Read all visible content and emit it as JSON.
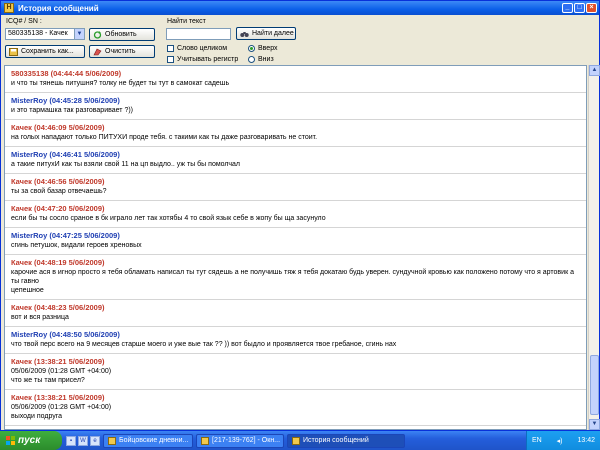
{
  "window": {
    "title": "История сообщений",
    "icon_text": "H"
  },
  "toolbar": {
    "icq_label": "ICQ# / SN :",
    "contact_value": "580335138 - Качек",
    "refresh_label": "Обновить",
    "save_label": "Сохранить как...",
    "clear_label": "Очистить",
    "find_label": "Найти текст",
    "find_value": "",
    "find_next_label": "Найти далее",
    "whole_word_label": "Слово целиком",
    "case_label": "Учитывать регистр",
    "up_label": "Вверх",
    "down_label": "Вниз"
  },
  "messages": [
    {
      "sender": "580335138",
      "time": "(04:44:44 5/06/2009)",
      "who": "them",
      "lines": [
        "и что ты тянешь питушня? толку не будет ты тут в самокат садешь"
      ]
    },
    {
      "sender": "MisterRoy",
      "time": "(04:45:28 5/06/2009)",
      "who": "me",
      "lines": [
        "и это тармашка так разговаривает ?))"
      ]
    },
    {
      "sender": "Качек",
      "time": "(04:46:09 5/06/2009)",
      "who": "them",
      "lines": [
        "на голых нападают только ПИТУХИ проде тебя. с такими как ты даже разговаривать не стоит."
      ]
    },
    {
      "sender": "MisterRoy",
      "time": "(04:46:41 5/06/2009)",
      "who": "me",
      "lines": [
        "а такие питухИ как ты взяли свой 11 на цп выдло.. уж ты бы помолчал"
      ]
    },
    {
      "sender": "Качек",
      "time": "(04:46:56 5/06/2009)",
      "who": "them",
      "lines": [
        "ты за свой базар отвечаешь?"
      ]
    },
    {
      "sender": "Качек",
      "time": "(04:47:20 5/06/2009)",
      "who": "them",
      "lines": [
        "если бы ты сосло сраное в бк играло лет так хотябы 4 то свой язык себе в жопу бы ща засунуло"
      ]
    },
    {
      "sender": "MisterRoy",
      "time": "(04:47:25 5/06/2009)",
      "who": "me",
      "lines": [
        "сгинь петушок, видали героев хреновых"
      ]
    },
    {
      "sender": "Качек",
      "time": "(04:48:19 5/06/2009)",
      "who": "them",
      "lines": [
        "карочие ася в игнор просто я тебя обламать написал ты тут сядешь а не получишь тяж я тебя докатаю будь уверен. сундучной кровью как положено потому что я артовик а ты гавно",
        "цепешное"
      ]
    },
    {
      "sender": "Качек",
      "time": "(04:48:23 5/06/2009)",
      "who": "them",
      "lines": [
        "вот и вся разница"
      ]
    },
    {
      "sender": "MisterRoy",
      "time": "(04:48:50 5/06/2009)",
      "who": "me",
      "lines": [
        "что твой перс всего на 9 месяцев старше моего и уже вые так ?? )) вот быдло и проявляется твое гребаное, сгинь нах"
      ]
    },
    {
      "sender": "Качек",
      "time": "(13:38:21 5/06/2009)",
      "who": "them",
      "lines": [
        "05/06/2009 (01:28 GMT  +04:00)",
        "что же ты там присел?"
      ]
    },
    {
      "sender": "Качек",
      "time": "(13:38:21 5/06/2009)",
      "who": "them",
      "lines": [
        "05/06/2009 (01:28 GMT  +04:00)",
        "выходи подруга"
      ]
    }
  ],
  "taskbar": {
    "start_label": "пуск",
    "tasks": [
      {
        "label": "Бойцовские дневни...",
        "active": false
      },
      {
        "label": "[217-139-762] - Окн...",
        "active": false
      },
      {
        "label": "История сообщений",
        "active": true
      }
    ],
    "lang": "EN",
    "clock": "13:42"
  },
  "colors": {
    "them": "#c0392b",
    "me": "#1f3fb3",
    "titlebar": "#0b5fe8"
  }
}
